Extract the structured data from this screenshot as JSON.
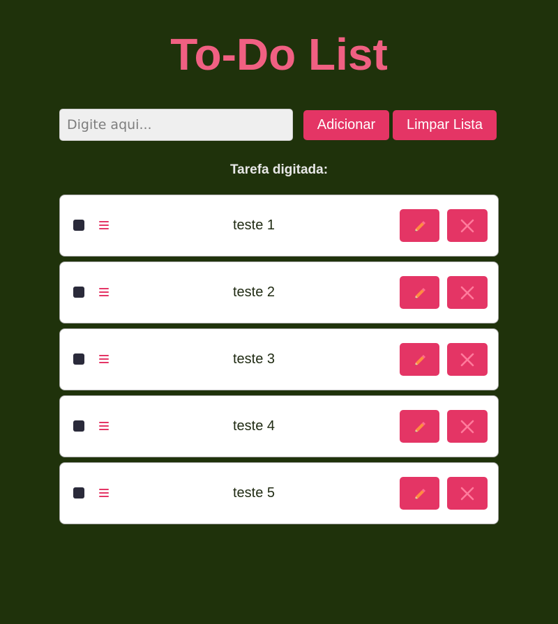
{
  "page": {
    "title": "To-Do List"
  },
  "input": {
    "placeholder": "Digite aqui...",
    "value": ""
  },
  "buttons": {
    "add_label": "Adicionar",
    "clear_label": "Limpar Lista"
  },
  "typed_label": "Tarefa digitada:",
  "tasks": [
    {
      "text": "teste 1",
      "checked": false
    },
    {
      "text": "teste 2",
      "checked": false
    },
    {
      "text": "teste 3",
      "checked": false
    },
    {
      "text": "teste 4",
      "checked": false
    },
    {
      "text": "teste 5",
      "checked": false
    }
  ],
  "icons": {
    "drag": "drag-handle-icon",
    "edit": "pencil-icon",
    "delete": "close-icon"
  },
  "colors": {
    "background": "#1f320b",
    "accent": "#e43565",
    "title": "#f06082",
    "card": "#ffffff",
    "checkbox": "#2a2a3a"
  }
}
